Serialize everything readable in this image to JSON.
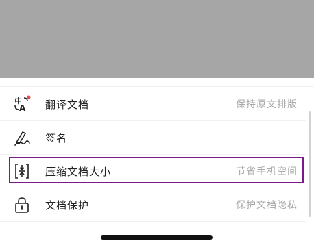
{
  "menu": {
    "items": [
      {
        "label": "翻译文档",
        "hint": "保持原文排版",
        "icon": "translate-icon"
      },
      {
        "label": "签名",
        "hint": "",
        "icon": "signature-icon"
      },
      {
        "label": "压缩文档大小",
        "hint": "节省手机空间",
        "icon": "compress-icon"
      },
      {
        "label": "文档保护",
        "hint": "保护文档隐私",
        "icon": "lock-icon"
      }
    ]
  },
  "colors": {
    "scrim": "#a6a6a6",
    "highlight_border": "#7b1b8a",
    "badge_dot": "#e5484d",
    "label": "#222222",
    "hint": "#a9a9a9"
  }
}
